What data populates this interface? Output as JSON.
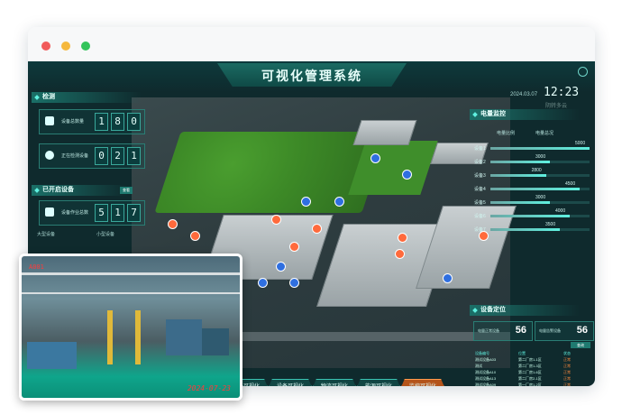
{
  "header": {
    "title": "可视化管理系统"
  },
  "clock": {
    "date": "2024.03.07",
    "time": "12:23",
    "weather": "阴转多云"
  },
  "detect": {
    "title": "检测",
    "stats": [
      {
        "label": "设备总数量",
        "digits": [
          "1",
          "8",
          "0"
        ]
      },
      {
        "label": "正在检测设备",
        "digits": [
          "0",
          "2",
          "1"
        ]
      }
    ]
  },
  "running": {
    "title": "已开启设备",
    "query": "查看",
    "stat": {
      "label": "设备作业总数",
      "digits": [
        "5",
        "1",
        "7"
      ]
    },
    "large_label": "大型设备",
    "small_label": "小型设备"
  },
  "energy": {
    "title": "电量监控",
    "legend": [
      "电量比例",
      "电量总况"
    ],
    "max": 5000,
    "rows": [
      {
        "label": "设备1",
        "value": 5000
      },
      {
        "label": "设备2",
        "value": 3000
      },
      {
        "label": "设备3",
        "value": 2800
      },
      {
        "label": "设备4",
        "value": 4500
      },
      {
        "label": "设备5",
        "value": 3000
      },
      {
        "label": "设备6",
        "value": 4000
      },
      {
        "label": "设备7",
        "value": 3500
      }
    ]
  },
  "position": {
    "title": "设备定位",
    "left": {
      "label": "电量正常设备",
      "value": "56"
    },
    "right": {
      "label": "电量告警设备",
      "value": "56"
    },
    "search": "查询",
    "headers": [
      "设备编号",
      "位置",
      "状态"
    ],
    "rows": [
      {
        "c1": "测试设备A03",
        "c2": "第二厂房1-1区",
        "c3": "正常"
      },
      {
        "c1": "测试",
        "c2": "第二厂房1-3区",
        "c3": "正常"
      },
      {
        "c1": "测试设备A10",
        "c2": "第二厂房1-6区",
        "c3": "正常"
      },
      {
        "c1": "测试设备A13",
        "c2": "第二厂房2-1区",
        "c3": "正常"
      },
      {
        "c1": "测试设备A09",
        "c2": "第一厂房1-2区",
        "c3": "正常"
      },
      {
        "c1": "测试设备A02",
        "c2": "第一厂房3-1区",
        "c3": "正常"
      }
    ]
  },
  "nav": [
    "设备可视化",
    "设备可视化",
    "物流可视化",
    "能源可视化",
    "监控可视化"
  ],
  "camera": {
    "id": "A001",
    "timestamp": "2024-07-23"
  }
}
